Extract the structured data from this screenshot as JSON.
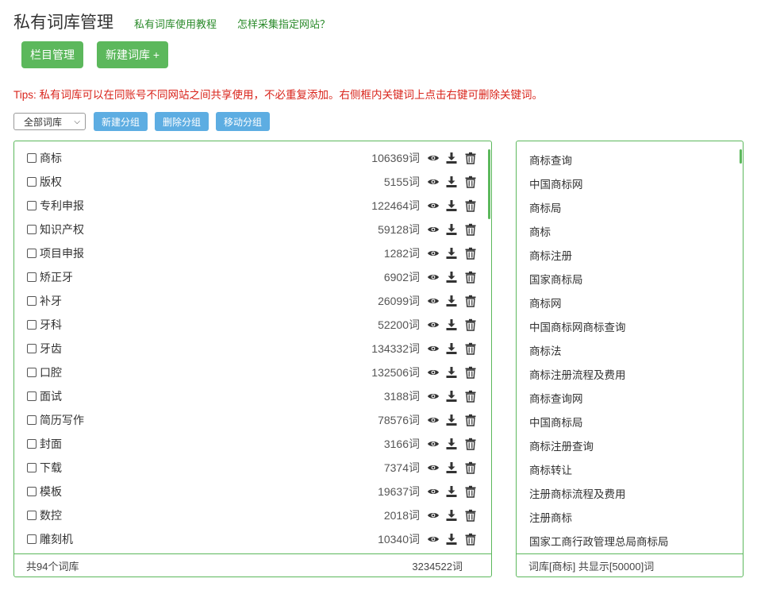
{
  "header": {
    "title": "私有词库管理",
    "link_tutorial": "私有词库使用教程",
    "link_collect": "怎样采集指定网站？"
  },
  "actions": {
    "column_manage": "栏目管理",
    "new_library": "新建词库 +"
  },
  "tips": "Tips: 私有词库可以在同账号不同网站之间共享使用，不必重复添加。右侧框内关键词上点击右键可删除关键词。",
  "toolbar": {
    "select_value": "全部词库",
    "new_group": "新建分组",
    "delete_group": "删除分组",
    "move_group": "移动分组"
  },
  "libraries": [
    {
      "name": "商标",
      "count": "106369词"
    },
    {
      "name": "版权",
      "count": "5155词"
    },
    {
      "name": "专利申报",
      "count": "122464词"
    },
    {
      "name": "知识产权",
      "count": "59128词"
    },
    {
      "name": "项目申报",
      "count": "1282词"
    },
    {
      "name": "矫正牙",
      "count": "6902词"
    },
    {
      "name": "补牙",
      "count": "26099词"
    },
    {
      "name": "牙科",
      "count": "52200词"
    },
    {
      "name": "牙齿",
      "count": "134332词"
    },
    {
      "name": "口腔",
      "count": "132506词"
    },
    {
      "name": "面试",
      "count": "3188词"
    },
    {
      "name": "简历写作",
      "count": "78576词"
    },
    {
      "name": "封面",
      "count": "3166词"
    },
    {
      "name": "下载",
      "count": "7374词"
    },
    {
      "name": "模板",
      "count": "19637词"
    },
    {
      "name": "数控",
      "count": "2018词"
    },
    {
      "name": "雕刻机",
      "count": "10340词"
    }
  ],
  "left_footer": {
    "total_libraries": "共94个词库",
    "total_words": "3234522词"
  },
  "keywords": [
    "商标查询",
    "中国商标网",
    "商标局",
    "商标",
    "商标注册",
    "国家商标局",
    "商标网",
    "中国商标网商标查询",
    "商标法",
    "商标注册流程及费用",
    "商标查询网",
    "中国商标局",
    "商标注册查询",
    "商标转让",
    "注册商标流程及费用",
    "注册商标",
    "国家工商行政管理总局商标局"
  ],
  "right_footer": "词库[商标] 共显示[50000]词",
  "colors": {
    "green": "#5cb85c",
    "blue": "#5dade2",
    "red": "#d9251c",
    "link_green": "#2a8a2a"
  },
  "icons": {
    "row_view": "eye-icon",
    "row_download": "download-icon",
    "row_delete": "trash-icon",
    "select_caret": "chevron-down-icon"
  }
}
